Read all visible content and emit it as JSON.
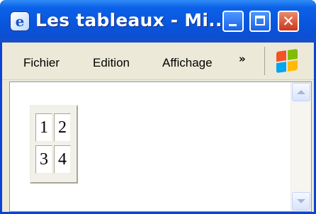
{
  "window": {
    "title": "Les tableaux - Mi...",
    "accent_color": "#0b61e8",
    "app_icon": "internet-explorer-icon",
    "controls": {
      "minimize_icon": "minimize-icon",
      "maximize_icon": "maximize-icon",
      "close_icon": "close-icon",
      "close_glyph": "✕"
    }
  },
  "menubar": {
    "items": [
      {
        "label": "Fichier"
      },
      {
        "label": "Edition"
      },
      {
        "label": "Affichage"
      }
    ],
    "overflow_label": "»",
    "logo_icon": "windows-logo-icon"
  },
  "content": {
    "table": {
      "rows": [
        [
          "1",
          "2"
        ],
        [
          "3",
          "4"
        ]
      ]
    },
    "scrollbar": {
      "up_icon": "scroll-up-icon",
      "down_icon": "scroll-down-icon"
    }
  }
}
